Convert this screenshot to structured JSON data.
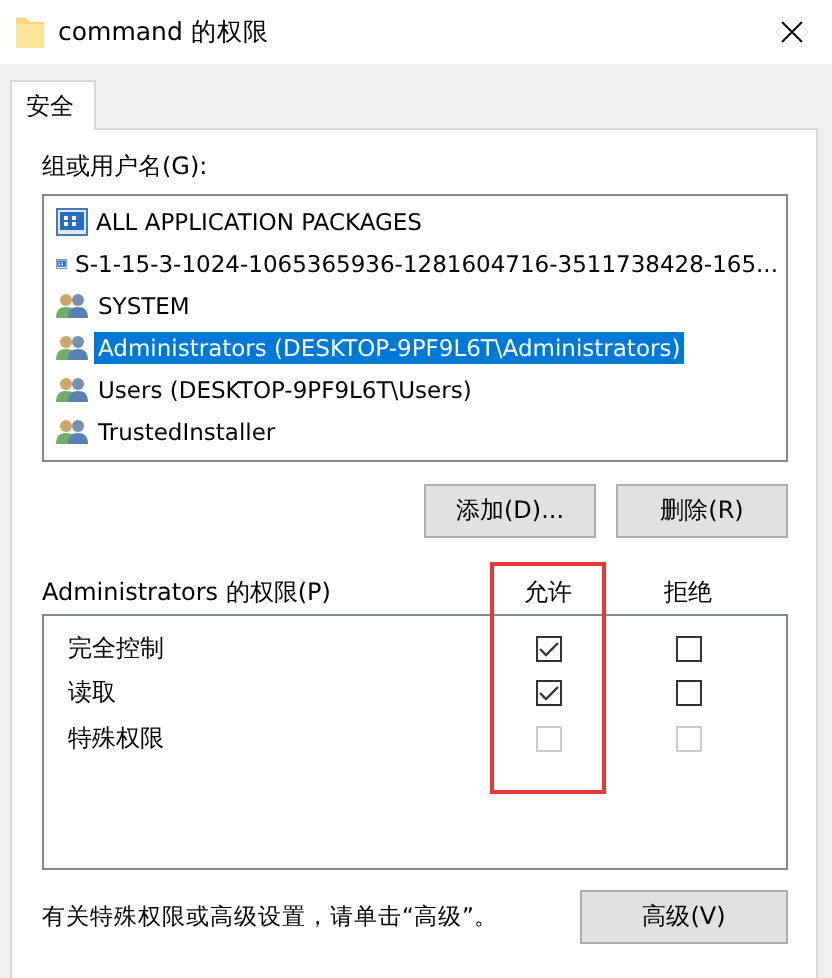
{
  "window": {
    "title": "command 的权限"
  },
  "tabs": [
    {
      "label": "安全",
      "selected": true
    }
  ],
  "groups_label": "组或用户名(G):",
  "principals": [
    {
      "name": "ALL APPLICATION PACKAGES",
      "kind": "package",
      "selected": false
    },
    {
      "name": "S-1-15-3-1024-1065365936-1281604716-3511738428-165...",
      "kind": "package",
      "selected": false
    },
    {
      "name": "SYSTEM",
      "kind": "group",
      "selected": false
    },
    {
      "name": "Administrators (DESKTOP-9PF9L6T\\Administrators)",
      "kind": "group",
      "selected": true
    },
    {
      "name": "Users (DESKTOP-9PF9L6T\\Users)",
      "kind": "group",
      "selected": false
    },
    {
      "name": "TrustedInstaller",
      "kind": "group",
      "selected": false
    }
  ],
  "list_buttons": [
    "添加(D)...",
    "删除(R)"
  ],
  "permissions_label": "Administrators 的权限(P)",
  "columns": [
    "允许",
    "拒绝"
  ],
  "allow_column_highlighted": true,
  "permissions": [
    {
      "name": "完全控制",
      "allow": {
        "checked": true,
        "disabled": false
      },
      "deny": {
        "checked": false,
        "disabled": false
      }
    },
    {
      "name": "读取",
      "allow": {
        "checked": true,
        "disabled": false
      },
      "deny": {
        "checked": false,
        "disabled": false
      }
    },
    {
      "name": "特殊权限",
      "allow": {
        "checked": false,
        "disabled": true
      },
      "deny": {
        "checked": false,
        "disabled": true
      }
    }
  ],
  "footer_text": "有关特殊权限或高级设置，请单击“高级”。",
  "advanced_button": "高级(V)"
}
